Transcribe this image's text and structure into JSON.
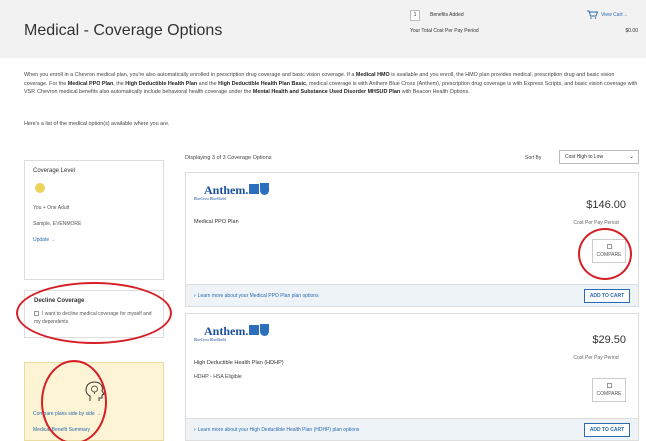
{
  "header": {
    "title": "Medical - Coverage Options",
    "benefits_count": "1",
    "benefits_added_label": "Benefits Added",
    "view_cart_label": "View Cart→",
    "total_label": "Your Total Cost Per Pay Period",
    "total_value": "$0.00"
  },
  "intro": {
    "text_1": "When you enroll in a Chevron medical plan, you're also automatically enrolled in prescription drug coverage and basic vision coverage. If a ",
    "bold_1": "Medical HMO",
    "text_2": " is available and you enroll, the HMO plan provides medical, prescription drug and basic vision coverage. For the ",
    "bold_2": "Medical PPO Plan",
    "text_3": ", the ",
    "bold_3": "High Deductible Health Plan",
    "text_4": " and the ",
    "bold_4": "High Deductible Health Plan Basic",
    "text_5": ", medical coverage is with Anthem Blue Cross (Anthem), prescription drug coverage is with Express Scripts, and basic vision coverage with VSP. Chevron medical benefits also automatically include behavioral health coverage under the ",
    "bold_5": "Mental Health and Substance Used Disorder MHSUD Plan",
    "text_6": " with Beacon Health Options.",
    "list_note": "Here's a list of the medical option(s) available where you are."
  },
  "sidebar": {
    "coverage_level_heading": "Coverage Level",
    "coverage_level_value": "You + One Adult",
    "dependent_name": "Sample, EVENMORE",
    "update_label": "Update →"
  },
  "decline": {
    "title": "Decline Coverage",
    "checkbox_label": "I want to decline medical coverage for myself and my dependents"
  },
  "compare_panel": {
    "compare_link": "Compare plans side by side →",
    "summary_link": "Medical Benefit Summary"
  },
  "results": {
    "displaying": "Displaying 3 of 3 Coverage Options",
    "sort_label": "Sort By",
    "sort_value": "Cost High to Low"
  },
  "logo": {
    "word": "Anthem.",
    "sub": "BlueCross BlueShield"
  },
  "plans": [
    {
      "name": "Medical PPO Plan",
      "subtitle": "",
      "price": "$146.00",
      "cost_label": "Cost Per Pay Period",
      "compare_label": "COMPARE",
      "learn_more": "Learn more about your Medical PPO Plan plan options",
      "add_label": "ADD TO CART"
    },
    {
      "name": "High Deductible Health Plan (HDHP)",
      "subtitle": "HDHP - HSA Eligible",
      "price": "$29.50",
      "cost_label": "Cost Per Pay Period",
      "compare_label": "COMPARE",
      "learn_more": "Learn more about your High Deductible Health Plan (HDHP) plan options",
      "add_label": "ADD TO CART"
    }
  ],
  "colors": {
    "accent": "#2a6ab2",
    "annotation": "#d62027",
    "compare_panel": "#fdf4d6"
  }
}
